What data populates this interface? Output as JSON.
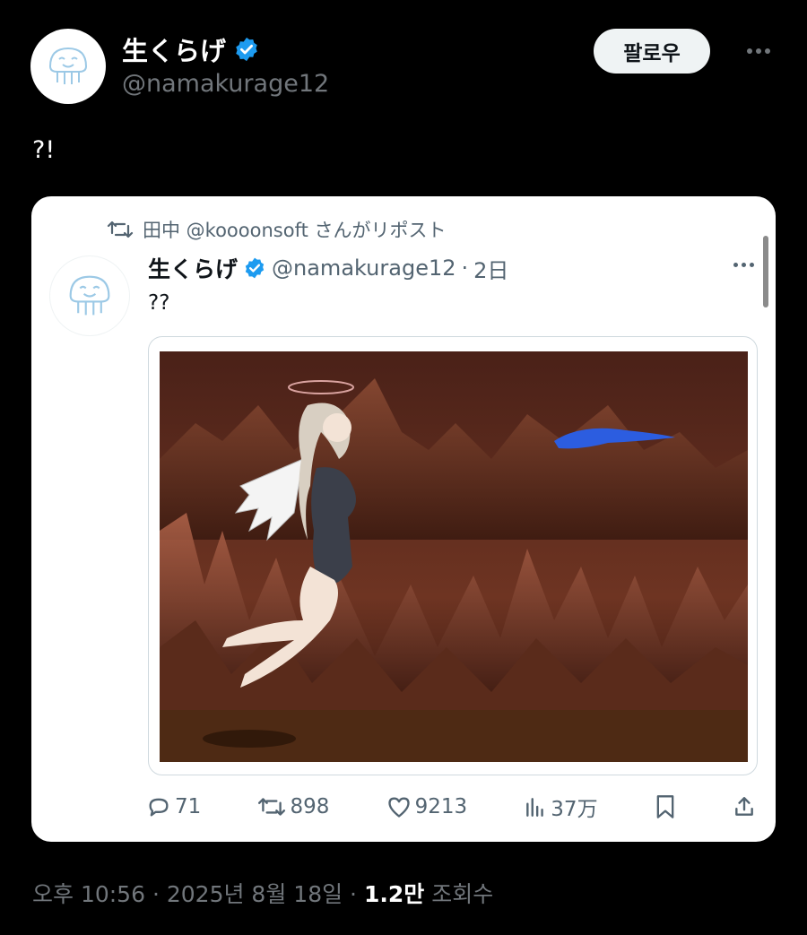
{
  "author": {
    "display_name": "生くらげ",
    "handle": "@namakurage12",
    "avatar_icon": "jellyfish-avatar-icon"
  },
  "header": {
    "follow_label": "팔로우"
  },
  "tweet": {
    "text": "?!"
  },
  "quoted": {
    "repost_by": "田中 @koooonsoft さんがリポスト",
    "display_name": "生くらげ",
    "handle": "@namakurage12",
    "separator": "·",
    "time": "2日",
    "text": "??",
    "actions": {
      "replies": "71",
      "reposts": "898",
      "likes": "9213",
      "views": "37万"
    }
  },
  "meta": {
    "time": "오후 10:56",
    "sep1": "·",
    "date": "2025년 8월 18일",
    "sep2": "·",
    "views_count": "1.2만",
    "views_label": "조회수"
  },
  "colors": {
    "background": "#000000",
    "verified": "#1d9bf0",
    "muted": "#71767b",
    "card": "#ffffff"
  }
}
